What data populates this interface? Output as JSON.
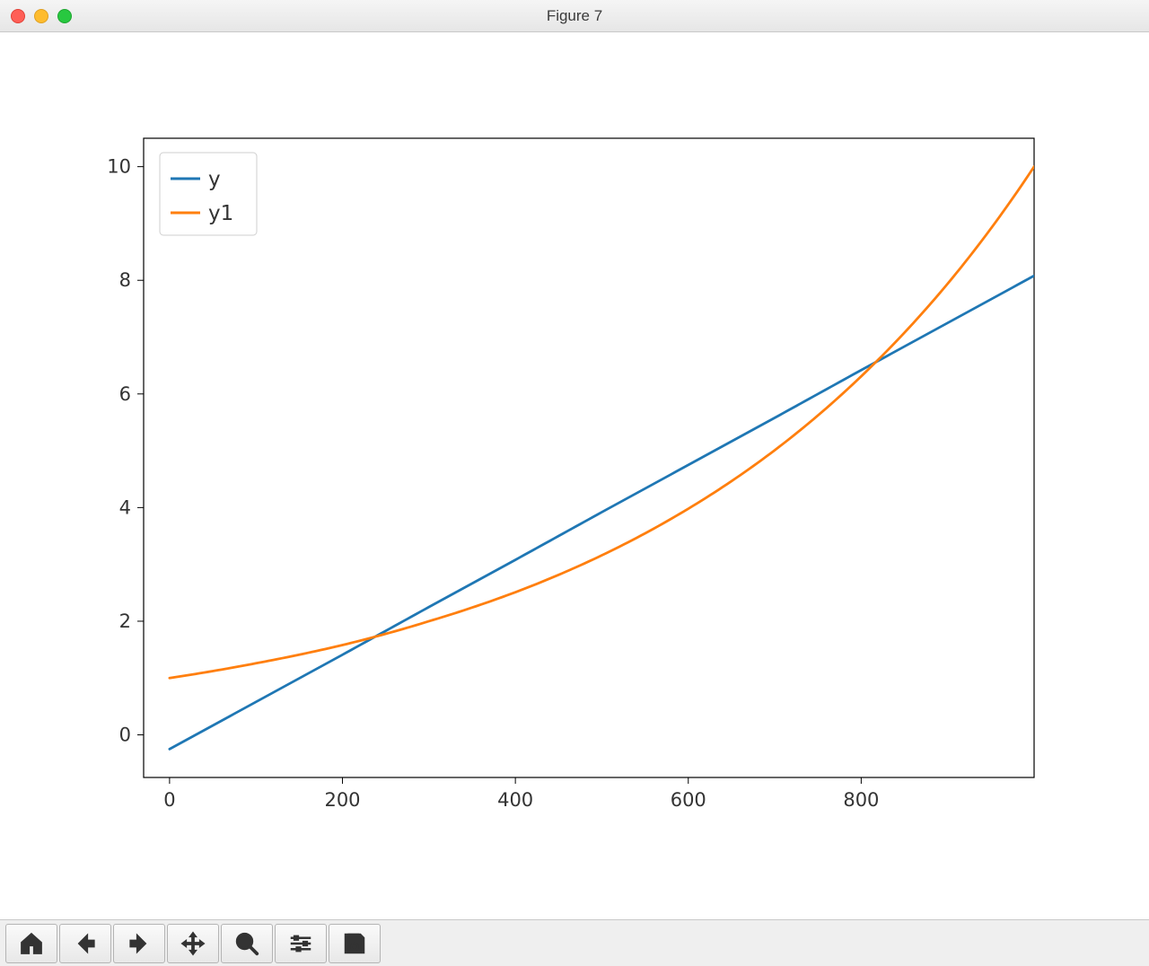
{
  "window": {
    "title": "Figure 7"
  },
  "toolbar": {
    "home": "Home",
    "back": "Back",
    "forward": "Forward",
    "pan": "Pan",
    "zoom": "Zoom",
    "config": "Configure subplots",
    "save": "Save"
  },
  "chart_data": {
    "type": "line",
    "x_ticks": [
      0,
      200,
      400,
      600,
      800
    ],
    "y_ticks": [
      0,
      2,
      4,
      6,
      8,
      10
    ],
    "xlim": [
      -30,
      1000
    ],
    "ylim": [
      -0.75,
      10.5
    ],
    "xlabel": "",
    "ylabel": "",
    "title": "",
    "legend_position": "upper-left",
    "series": [
      {
        "name": "y",
        "color": "#1f77b4",
        "x": [
          0,
          100,
          200,
          300,
          400,
          500,
          600,
          700,
          800,
          900,
          1000
        ],
        "y": [
          -0.25,
          0.58,
          1.41,
          2.25,
          3.08,
          3.92,
          4.75,
          5.58,
          6.42,
          7.25,
          8.08
        ]
      },
      {
        "name": "y1",
        "color": "#ff7f0e",
        "x": [
          0,
          100,
          200,
          300,
          400,
          500,
          600,
          700,
          800,
          900,
          1000
        ],
        "y": [
          1.0,
          1.26,
          1.58,
          2.0,
          2.51,
          3.16,
          3.98,
          5.01,
          6.31,
          7.94,
          10.0
        ]
      }
    ]
  }
}
